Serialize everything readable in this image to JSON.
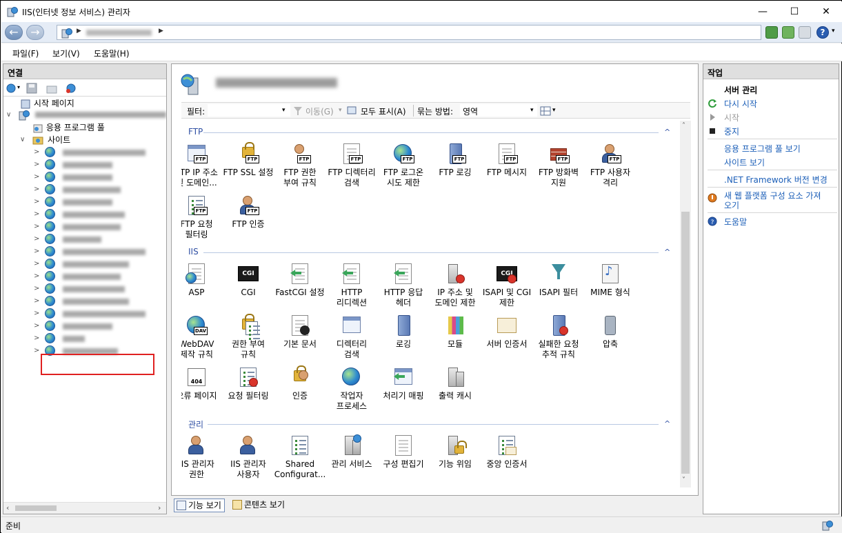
{
  "window": {
    "title": "IIS(인터넷 정보 서비스) 관리자",
    "minimize_glyph": "—",
    "maximize_glyph": "☐",
    "close_glyph": "✕"
  },
  "navbar": {
    "back_glyph": "←",
    "forward_glyph": "→",
    "address_arrow": "▶",
    "address_arrow_end": "▶",
    "help_glyph": "?",
    "help_dd_glyph": "▾"
  },
  "menu": [
    "파일(F)",
    "보기(V)",
    "도움말(H)"
  ],
  "connections": {
    "title": "연결",
    "start_page": "시작 페이지",
    "app_pools": "응용 프로그램 풀",
    "sites": "사이트",
    "expand_glyph": ">",
    "collapse_glyph": "∨"
  },
  "center": {
    "filter_label": "필터:",
    "go_label": "이동(G)",
    "show_all_label": "모두 표시(A)",
    "group_by_label": "묶는 방법:",
    "group_by_value": "영역",
    "dd_glyph": "▾",
    "collapse_glyph": "^",
    "groups": {
      "ftp": "FTP",
      "iis": "IIS",
      "mgmt": "관리"
    },
    "ftp_features": [
      [
        "FTP IP 주소",
        "및 도메인..."
      ],
      [
        "FTP SSL 설정",
        ""
      ],
      [
        "FTP 권한",
        "부여 규칙"
      ],
      [
        "FTP 디렉터리",
        "검색"
      ],
      [
        "FTP 로그온",
        "시도 제한"
      ],
      [
        "FTP 로깅",
        ""
      ],
      [
        "FTP 메시지",
        ""
      ],
      [
        "FTP 방화벽",
        "지원"
      ],
      [
        "FTP 사용자",
        "격리"
      ],
      [
        "FTP 요청",
        "필터링"
      ],
      [
        "FTP 인증",
        ""
      ]
    ],
    "iis_features": [
      [
        "ASP",
        ""
      ],
      [
        "CGI",
        ""
      ],
      [
        "FastCGI 설정",
        ""
      ],
      [
        "HTTP",
        "리디렉션"
      ],
      [
        "HTTP 응답",
        "헤더"
      ],
      [
        "IP 주소 및",
        "도메인 제한"
      ],
      [
        "ISAPI 및 CGI",
        "제한"
      ],
      [
        "ISAPI 필터",
        ""
      ],
      [
        "MIME 형식",
        ""
      ],
      [
        "WebDAV",
        "제작 규칙"
      ],
      [
        "권한 부여",
        "규칙"
      ],
      [
        "기본 문서",
        ""
      ],
      [
        "디렉터리",
        "검색"
      ],
      [
        "로깅",
        ""
      ],
      [
        "모듈",
        ""
      ],
      [
        "서버 인증서",
        ""
      ],
      [
        "실패한 요청",
        "추적 규칙"
      ],
      [
        "압축",
        ""
      ],
      [
        "오류 페이지",
        ""
      ],
      [
        "요청 필터링",
        ""
      ],
      [
        "인증",
        ""
      ],
      [
        "작업자",
        "프로세스"
      ],
      [
        "처리기 매핑",
        ""
      ],
      [
        "출력 캐시",
        ""
      ]
    ],
    "mgmt_features": [
      [
        "IIS 관리자",
        "권한"
      ],
      [
        "IIS 관리자",
        "사용자"
      ],
      [
        "Shared",
        "Configurat..."
      ],
      [
        "관리 서비스",
        ""
      ],
      [
        "구성 편집기",
        ""
      ],
      [
        "기능 위임",
        ""
      ],
      [
        "중앙 인증서",
        ""
      ]
    ],
    "cgi_badge": "CGI",
    "ftp_badge": "FTP",
    "err_badge": "404",
    "webdav_badge": "DAV"
  },
  "actions": {
    "title": "작업",
    "server_manage": "서버 관리",
    "restart": "다시 시작",
    "start": "시작",
    "stop": "중지",
    "view_app_pools": "응용 프로그램 풀 보기",
    "view_sites": "사이트 보기",
    "net_fw": ".NET Framework 버전 변경",
    "new_platform": "새 웹 플랫폼 구성 요소 가져",
    "new_platform_2": "오기",
    "help": "도움말"
  },
  "bottom_tabs": {
    "features_view": "기능 보기",
    "content_view": "콘텐츠 보기"
  },
  "status": {
    "text": "준비"
  },
  "colors": {
    "link": "#1c5fb8",
    "highlight_box": "#e02020",
    "group_header": "#2f4fa3"
  }
}
